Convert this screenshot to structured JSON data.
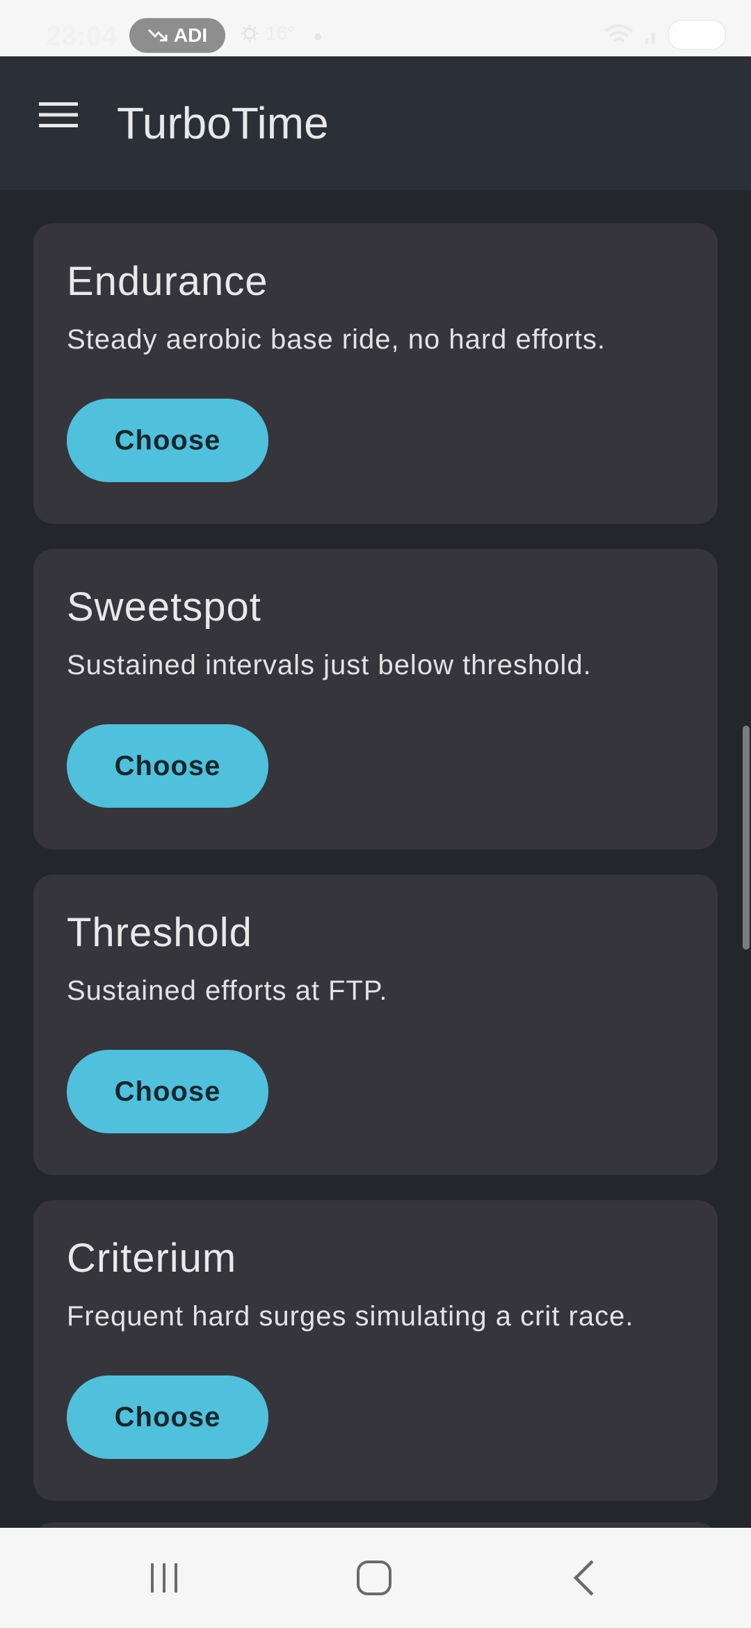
{
  "status_bar": {
    "time": "23:04",
    "carrier_label": "ADI",
    "temperature": "16°"
  },
  "app_bar": {
    "title": "TurboTime"
  },
  "workouts": [
    {
      "title": "Endurance",
      "description": "Steady aerobic base ride, no hard efforts.",
      "button_label": "Choose"
    },
    {
      "title": "Sweetspot",
      "description": "Sustained intervals just below threshold.",
      "button_label": "Choose"
    },
    {
      "title": "Threshold",
      "description": "Sustained efforts at FTP.",
      "button_label": "Choose"
    },
    {
      "title": "Criterium",
      "description": "Frequent hard surges simulating a crit race.",
      "button_label": "Choose"
    }
  ],
  "colors": {
    "accent": "#4fc1dc",
    "card_background": "#36353b",
    "app_bar_background": "#2b2f36",
    "page_background": "#23262b"
  },
  "icons": {
    "menu": "hamburger-menu-icon",
    "recents": "recents-icon",
    "home": "home-icon",
    "back": "back-icon"
  }
}
